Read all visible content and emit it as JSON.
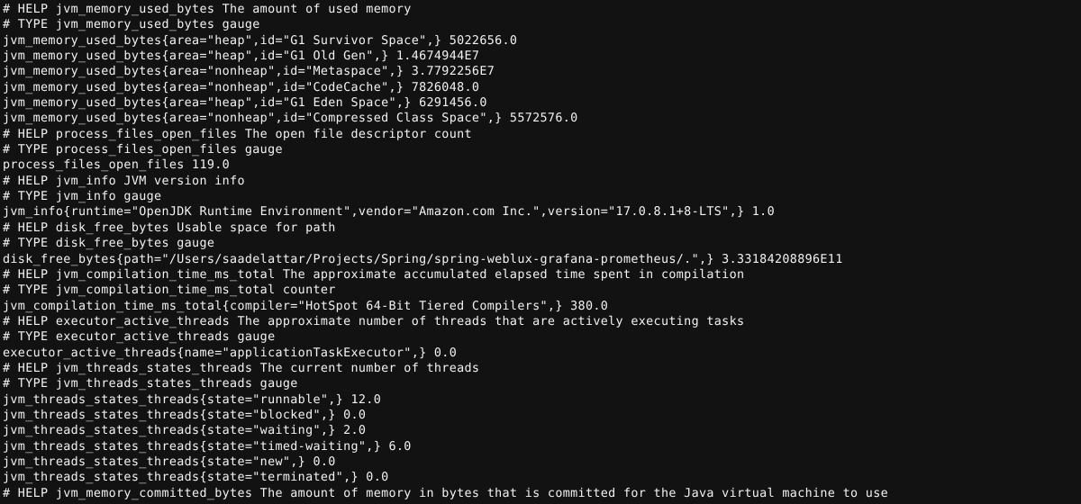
{
  "terminal": {
    "background_color": "#121212",
    "text_color": "#f2f2f2",
    "content_type": "prometheus-metrics-exposition"
  },
  "lines": [
    {
      "id": "help-jvm-memory-used-bytes",
      "kind": "comment",
      "text": "# HELP jvm_memory_used_bytes The amount of used memory"
    },
    {
      "id": "type-jvm-memory-used-bytes",
      "kind": "comment",
      "text": "# TYPE jvm_memory_used_bytes gauge"
    },
    {
      "id": "jvm-memory-used-bytes-g1-survivor-space",
      "kind": "sample",
      "text": "jvm_memory_used_bytes{area=\"heap\",id=\"G1 Survivor Space\",} 5022656.0"
    },
    {
      "id": "jvm-memory-used-bytes-g1-old-gen",
      "kind": "sample",
      "text": "jvm_memory_used_bytes{area=\"heap\",id=\"G1 Old Gen\",} 1.4674944E7"
    },
    {
      "id": "jvm-memory-used-bytes-metaspace",
      "kind": "sample",
      "text": "jvm_memory_used_bytes{area=\"nonheap\",id=\"Metaspace\",} 3.7792256E7"
    },
    {
      "id": "jvm-memory-used-bytes-codecache",
      "kind": "sample",
      "text": "jvm_memory_used_bytes{area=\"nonheap\",id=\"CodeCache\",} 7826048.0"
    },
    {
      "id": "jvm-memory-used-bytes-g1-eden-space",
      "kind": "sample",
      "text": "jvm_memory_used_bytes{area=\"heap\",id=\"G1 Eden Space\",} 6291456.0"
    },
    {
      "id": "jvm-memory-used-bytes-compressed-class-space",
      "kind": "sample",
      "text": "jvm_memory_used_bytes{area=\"nonheap\",id=\"Compressed Class Space\",} 5572576.0"
    },
    {
      "id": "help-process-files-open-files",
      "kind": "comment",
      "text": "# HELP process_files_open_files The open file descriptor count"
    },
    {
      "id": "type-process-files-open-files",
      "kind": "comment",
      "text": "# TYPE process_files_open_files gauge"
    },
    {
      "id": "process-files-open-files",
      "kind": "sample",
      "text": "process_files_open_files 119.0"
    },
    {
      "id": "help-jvm-info",
      "kind": "comment",
      "text": "# HELP jvm_info JVM version info"
    },
    {
      "id": "type-jvm-info",
      "kind": "comment",
      "text": "# TYPE jvm_info gauge"
    },
    {
      "id": "jvm-info",
      "kind": "sample",
      "text": "jvm_info{runtime=\"OpenJDK Runtime Environment\",vendor=\"Amazon.com Inc.\",version=\"17.0.8.1+8-LTS\",} 1.0"
    },
    {
      "id": "help-disk-free-bytes",
      "kind": "comment",
      "text": "# HELP disk_free_bytes Usable space for path"
    },
    {
      "id": "type-disk-free-bytes",
      "kind": "comment",
      "text": "# TYPE disk_free_bytes gauge"
    },
    {
      "id": "disk-free-bytes",
      "kind": "sample",
      "text": "disk_free_bytes{path=\"/Users/saadelattar/Projects/Spring/spring-weblux-grafana-prometheus/.\",} 3.33184208896E11"
    },
    {
      "id": "help-jvm-compilation-time-ms-total",
      "kind": "comment",
      "text": "# HELP jvm_compilation_time_ms_total The approximate accumulated elapsed time spent in compilation"
    },
    {
      "id": "type-jvm-compilation-time-ms-total",
      "kind": "comment",
      "text": "# TYPE jvm_compilation_time_ms_total counter"
    },
    {
      "id": "jvm-compilation-time-ms-total",
      "kind": "sample",
      "text": "jvm_compilation_time_ms_total{compiler=\"HotSpot 64-Bit Tiered Compilers\",} 380.0"
    },
    {
      "id": "help-executor-active-threads",
      "kind": "comment",
      "text": "# HELP executor_active_threads The approximate number of threads that are actively executing tasks"
    },
    {
      "id": "type-executor-active-threads",
      "kind": "comment",
      "text": "# TYPE executor_active_threads gauge"
    },
    {
      "id": "executor-active-threads",
      "kind": "sample",
      "text": "executor_active_threads{name=\"applicationTaskExecutor\",} 0.0"
    },
    {
      "id": "help-jvm-threads-states-threads",
      "kind": "comment",
      "text": "# HELP jvm_threads_states_threads The current number of threads"
    },
    {
      "id": "type-jvm-threads-states-threads",
      "kind": "comment",
      "text": "# TYPE jvm_threads_states_threads gauge"
    },
    {
      "id": "jvm-threads-states-threads-runnable",
      "kind": "sample",
      "text": "jvm_threads_states_threads{state=\"runnable\",} 12.0"
    },
    {
      "id": "jvm-threads-states-threads-blocked",
      "kind": "sample",
      "text": "jvm_threads_states_threads{state=\"blocked\",} 0.0"
    },
    {
      "id": "jvm-threads-states-threads-waiting",
      "kind": "sample",
      "text": "jvm_threads_states_threads{state=\"waiting\",} 2.0"
    },
    {
      "id": "jvm-threads-states-threads-timed-waiting",
      "kind": "sample",
      "text": "jvm_threads_states_threads{state=\"timed-waiting\",} 6.0"
    },
    {
      "id": "jvm-threads-states-threads-new",
      "kind": "sample",
      "text": "jvm_threads_states_threads{state=\"new\",} 0.0"
    },
    {
      "id": "jvm-threads-states-threads-terminated",
      "kind": "sample",
      "text": "jvm_threads_states_threads{state=\"terminated\",} 0.0"
    },
    {
      "id": "help-jvm-memory-committed-bytes",
      "kind": "comment",
      "text": "# HELP jvm_memory_committed_bytes The amount of memory in bytes that is committed for the Java virtual machine to use"
    }
  ]
}
